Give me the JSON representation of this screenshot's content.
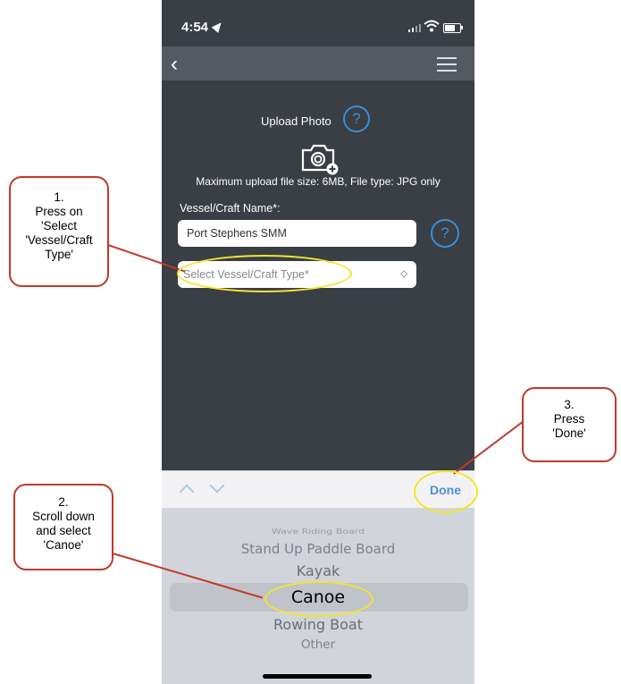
{
  "status_bar": {
    "time": "4:54"
  },
  "form": {
    "upload_label": "Upload Photo",
    "help_symbol": "?",
    "max_info": "Maximum upload file size: 6MB, File type: JPG only",
    "vessel_label": "Vessel/Craft Name*:",
    "vessel_name_value": "Port Stephens SMM",
    "type_placeholder": "Select Vessel/Craft Type*",
    "type_select_arrows": "◇"
  },
  "toolbar": {
    "done_label": "Done"
  },
  "picker": {
    "items": [
      "Wave Riding Board",
      "Stand Up Paddle Board",
      "Kayak",
      "Canoe",
      "Rowing Boat",
      "Other"
    ],
    "selected": "Canoe"
  },
  "annotations": {
    "step1": [
      "1.",
      "Press on",
      "'Select",
      "'Vessel/Craft",
      "Type'"
    ],
    "step2": [
      "2.",
      "Scroll down",
      "and select",
      "'Canoe'"
    ],
    "step3": [
      "3.",
      "Press",
      "'Done'"
    ]
  },
  "colors": {
    "accent": "#3b8fd4",
    "callout_border": "#c0392b",
    "highlight": "#f2e52a",
    "done": "#4a90d9"
  }
}
